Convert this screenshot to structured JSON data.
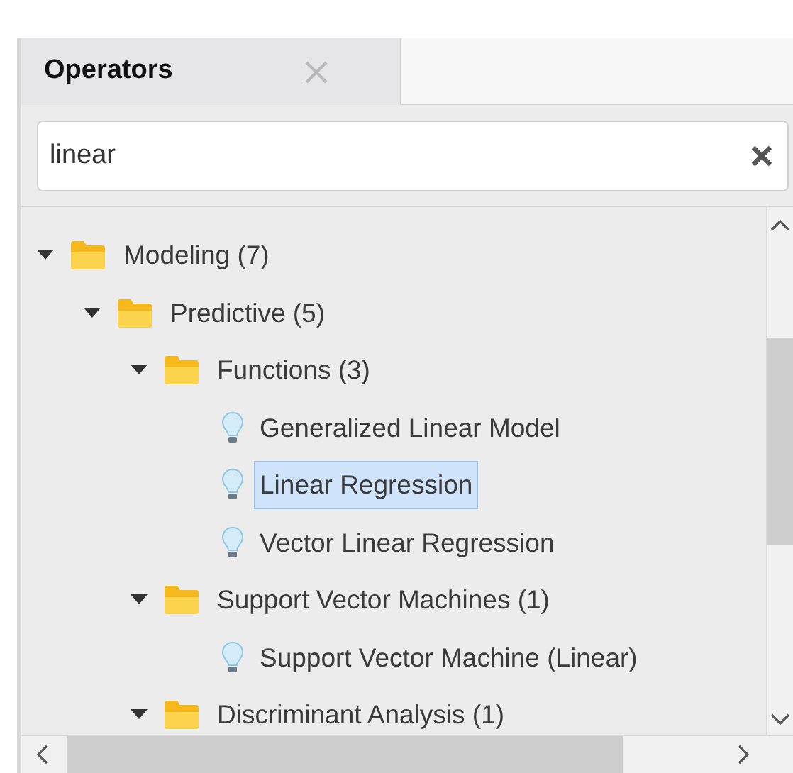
{
  "tabs": [
    {
      "label": "Operators",
      "selected": true
    }
  ],
  "search": {
    "value": "linear"
  },
  "tree": [
    {
      "kind": "folder",
      "label": "Modeling (7)",
      "expanded": true,
      "selected": false,
      "children": [
        {
          "kind": "folder",
          "label": "Predictive (5)",
          "expanded": true,
          "selected": false,
          "children": [
            {
              "kind": "folder",
              "label": "Functions (3)",
              "expanded": true,
              "selected": false,
              "children": [
                {
                  "kind": "operator",
                  "label": "Generalized Linear Model",
                  "selected": false
                },
                {
                  "kind": "operator",
                  "label": "Linear Regression",
                  "selected": true
                },
                {
                  "kind": "operator",
                  "label": "Vector Linear Regression",
                  "selected": false
                }
              ]
            },
            {
              "kind": "folder",
              "label": "Support Vector Machines (1)",
              "expanded": true,
              "selected": false,
              "children": [
                {
                  "kind": "operator",
                  "label": "Support Vector Machine (Linear)",
                  "selected": false
                }
              ]
            },
            {
              "kind": "folder",
              "label": "Discriminant Analysis (1)",
              "expanded": true,
              "selected": false
            }
          ]
        }
      ]
    }
  ]
}
